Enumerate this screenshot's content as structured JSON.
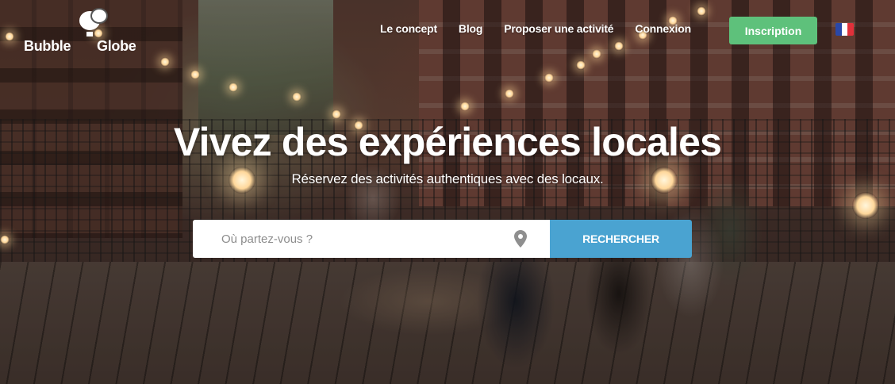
{
  "brand": {
    "name_part1": "Bubble",
    "name_part2": "Globe"
  },
  "nav": {
    "items": [
      "Le concept",
      "Blog",
      "Proposer une activité",
      "Connexion"
    ]
  },
  "signup_button": {
    "label": "Inscription"
  },
  "language": {
    "flag": "fr-flag-icon",
    "colors": [
      "#2a48a8",
      "#ffffff",
      "#e0303a"
    ]
  },
  "hero": {
    "title": "Vivez des expériences locales",
    "subtitle": "Réservez des activités authentiques avec des locaux."
  },
  "search": {
    "placeholder": "Où partez-vous ?",
    "value": "",
    "button_label": "RECHERCHER",
    "icon": "map-pin-icon"
  },
  "colors": {
    "signup": "#5ec17b",
    "search_button": "#4aa3d1",
    "pin": "#8f8f8f"
  }
}
